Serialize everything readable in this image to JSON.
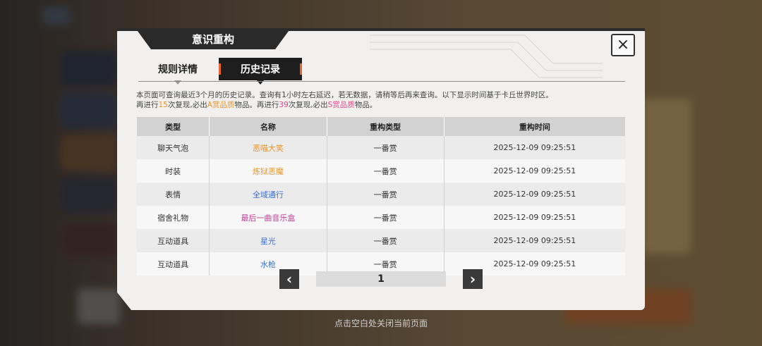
{
  "dialog": {
    "title": "意识重构",
    "close_icon": "×"
  },
  "tabs": [
    {
      "label": "规则详情",
      "active": false
    },
    {
      "label": "历史记录",
      "active": true
    }
  ],
  "notice": {
    "line1": "本页面可查询最近3个月的历史记录。查询有1小时左右延迟，若无数据，请稍等后再来查询。以下显示时间基于卡丘世界时区。",
    "line2_a": "再进行",
    "line2_n1": "15",
    "line2_b": "次复现,必出",
    "line2_q1": "A赏品质",
    "line2_c": "物品。再进行",
    "line2_n2": "39",
    "line2_d": "次复现,必出",
    "line2_q2": "S赏品质",
    "line2_e": "物品。"
  },
  "table": {
    "headers": [
      "类型",
      "名称",
      "重构类型",
      "重构时间"
    ],
    "rows": [
      {
        "type": "聊天气泡",
        "name": "恶喵大笑",
        "name_color": "#e8942a",
        "kind": "一番赏",
        "time": "2025-12-09   09:25:51"
      },
      {
        "type": "时装",
        "name": "炼狱恶魔",
        "name_color": "#e8942a",
        "kind": "一番赏",
        "time": "2025-12-09   09:25:51"
      },
      {
        "type": "表情",
        "name": "全域通行",
        "name_color": "#3b6fd6",
        "kind": "一番赏",
        "time": "2025-12-09   09:25:51"
      },
      {
        "type": "宿舍礼物",
        "name": "最后一曲音乐盒",
        "name_color": "#c0409a",
        "kind": "一番赏",
        "time": "2025-12-09   09:25:51"
      },
      {
        "type": "互动道具",
        "name": "星光",
        "name_color": "#3b6fd6",
        "kind": "一番赏",
        "time": "2025-12-09   09:25:51"
      },
      {
        "type": "互动道具",
        "name": "水枪",
        "name_color": "#3b6fd6",
        "kind": "一番赏",
        "time": "2025-12-09   09:25:51"
      }
    ]
  },
  "pager": {
    "prev_icon": "‹",
    "next_icon": "›",
    "page": "1"
  },
  "hint": "点击空白处关闭当前页面"
}
